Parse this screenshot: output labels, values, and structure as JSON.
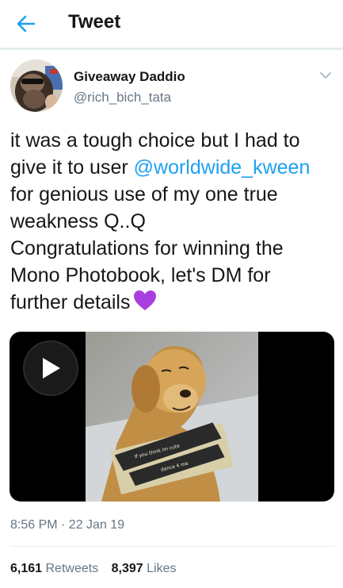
{
  "header": {
    "title": "Tweet",
    "back_icon": "arrow-left-icon",
    "accent_color": "#1da1f2"
  },
  "author": {
    "display_name": "Giveaway Daddio",
    "handle": "@rich_bich_tata"
  },
  "tweet": {
    "line1": "it was a tough choice but I had to",
    "line2_prefix": "give it to user ",
    "mention": "@worldwide_kween",
    "line3": "for genious use of my one true",
    "line4": "weakness Q..Q",
    "line5": "Congratulations for winning the",
    "line6": "Mono Photobook, let's DM for",
    "line7": "further details",
    "emoji": "purple-heart-icon"
  },
  "media": {
    "type": "video",
    "sign_line1": "If you think im cute",
    "sign_line2": "dance 4 me"
  },
  "meta": {
    "timestamp": "8:56 PM · 22 Jan 19"
  },
  "stats": {
    "retweets_count": "6,161",
    "retweets_label": "Retweets",
    "likes_count": "8,397",
    "likes_label": "Likes"
  }
}
